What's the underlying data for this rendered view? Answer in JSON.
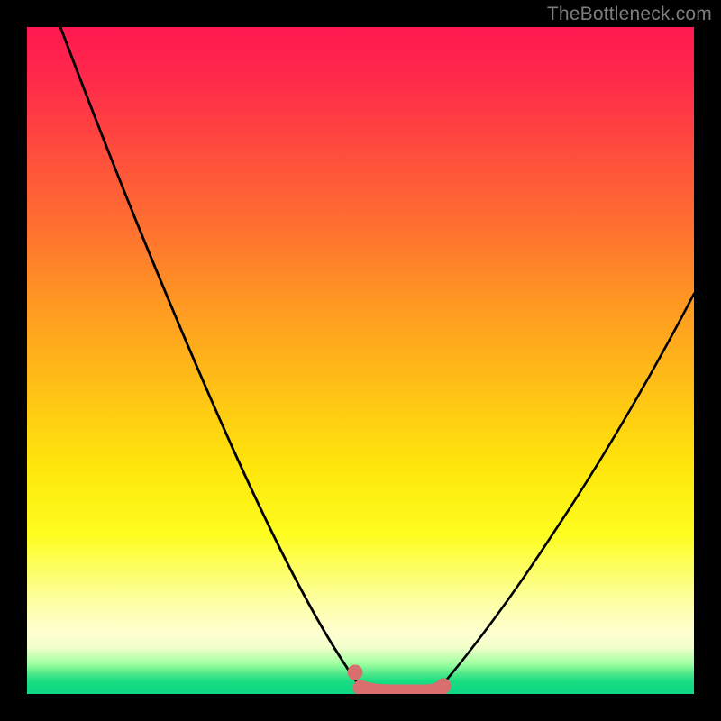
{
  "watermark": {
    "text": "TheBottleneck.com"
  },
  "colors": {
    "background": "#000000",
    "curve": "#000000",
    "accent": "#d96e6f"
  },
  "chart_data": {
    "type": "line",
    "title": "",
    "xlabel": "",
    "ylabel": "",
    "xlim": [
      0,
      100
    ],
    "ylim": [
      0,
      100
    ],
    "grid": false,
    "series": [
      {
        "name": "left-curve",
        "x": [
          5,
          10,
          15,
          20,
          25,
          30,
          35,
          40,
          45,
          48,
          50
        ],
        "y": [
          100,
          88,
          75,
          63,
          50,
          38,
          26,
          14,
          5,
          1,
          0
        ]
      },
      {
        "name": "right-curve",
        "x": [
          62,
          65,
          70,
          75,
          80,
          85,
          90,
          95,
          100
        ],
        "y": [
          0,
          2,
          9,
          17,
          25,
          34,
          43,
          52,
          60
        ]
      },
      {
        "name": "valley-floor",
        "x": [
          50,
          52,
          55,
          58,
          60,
          62
        ],
        "y": [
          0,
          0,
          0,
          0,
          0,
          0
        ]
      }
    ],
    "annotations": [
      {
        "name": "accent-bump",
        "x_range": [
          49,
          62
        ],
        "y": 0
      }
    ]
  }
}
